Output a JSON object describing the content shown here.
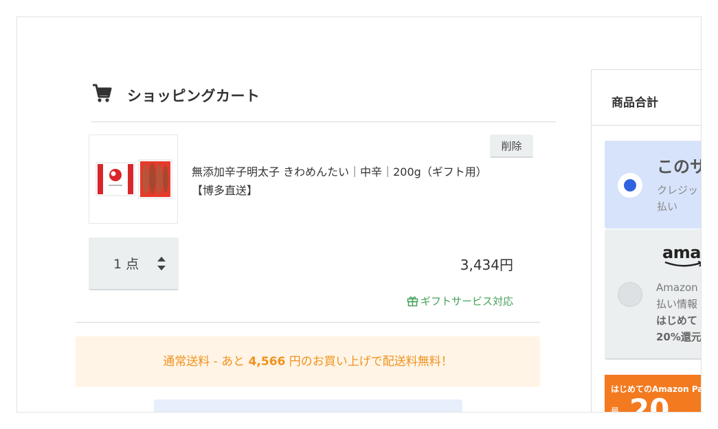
{
  "cart": {
    "title": "ショッピングカート",
    "item": {
      "name": "無添加辛子明太子 きわめんたい｜中辛｜200g（ギフト用）【博多直送】",
      "delete_label": "削除",
      "quantity": "1 点",
      "price": "3,434円",
      "gift_label": "ギフトサービス対応"
    },
    "shipping": {
      "prefix": "通常送料 - あと ",
      "amount": "4,566",
      "suffix": " 円のお買い上げで配送料無料！"
    }
  },
  "summary": {
    "title": "商品合計",
    "option1": {
      "title": "このサ",
      "line1": "クレジッ",
      "line2": "払い"
    },
    "option2": {
      "logo": "amaz",
      "line1": "Amazon",
      "line2": "払い情報",
      "line3": "はじめて",
      "line4": "20%還元"
    },
    "banner": {
      "text": "はじめてのAmazon Payで",
      "big": "20",
      "small": "最"
    }
  },
  "colors": {
    "gift": "#46a058",
    "shipping_text": "#f0921e",
    "shipping_bg": "#fff4e6",
    "selected_radio": "#2f63e0",
    "banner": "#f47a1f"
  },
  "icons": [
    "cart-icon",
    "gift-icon",
    "sort-arrows-icon",
    "amazon-smile-icon"
  ]
}
